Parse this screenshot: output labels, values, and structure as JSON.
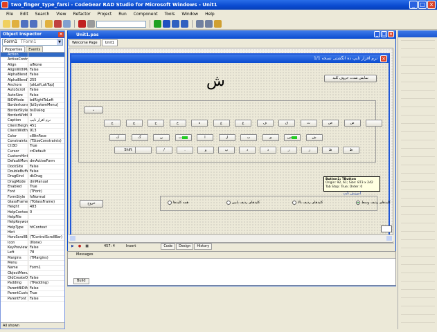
{
  "window": {
    "title": "two_finger_type_farsi - CodeGear RAD Studio for Microsoft Windows - Unit1"
  },
  "menu": [
    "File",
    "Edit",
    "Search",
    "View",
    "Refactor",
    "Project",
    "Run",
    "Component",
    "Tools",
    "Window",
    "Help"
  ],
  "toolbar": {
    "desktop_combo": ""
  },
  "object_inspector": {
    "title": "Object Inspector",
    "selected_object": "Form1",
    "selected_object_type": "TForm1",
    "tabs": [
      "Properties",
      "Events"
    ],
    "properties": [
      [
        "Action",
        ""
      ],
      [
        "ActiveControl",
        ""
      ],
      [
        "Align",
        "alNone"
      ],
      [
        "AlignWithMargins",
        "False"
      ],
      [
        "AlphaBlend",
        "False"
      ],
      [
        "AlphaBlendValue",
        "255"
      ],
      [
        "Anchors",
        "[akLeft,akTop]"
      ],
      [
        "AutoScroll",
        "False"
      ],
      [
        "AutoSize",
        "False"
      ],
      [
        "BiDiMode",
        "bdRightToLeft"
      ],
      [
        "BorderIcons",
        "[biSystemMenu]"
      ],
      [
        "BorderStyle",
        "bsDialog"
      ],
      [
        "BorderWidth",
        "0"
      ],
      [
        "Caption",
        "نرم افزار تایپ"
      ],
      [
        "ClientHeight",
        "451"
      ],
      [
        "ClientWidth",
        "913"
      ],
      [
        "Color",
        "clBtnFace"
      ],
      [
        "Constraints",
        "(TSizeConstraints)"
      ],
      [
        "Ctl3D",
        "True"
      ],
      [
        "Cursor",
        "crDefault"
      ],
      [
        "CustomHint",
        ""
      ],
      [
        "DefaultMonitor",
        "dmActiveForm"
      ],
      [
        "DockSite",
        "False"
      ],
      [
        "DoubleBuffered",
        "False"
      ],
      [
        "DragKind",
        "dkDrag"
      ],
      [
        "DragMode",
        "dmManual"
      ],
      [
        "Enabled",
        "True"
      ],
      [
        "Font",
        "(TFont)"
      ],
      [
        "FormStyle",
        "fsNormal"
      ],
      [
        "GlassFrame",
        "(TGlassFrame)"
      ],
      [
        "Height",
        "483"
      ],
      [
        "HelpContext",
        "0"
      ],
      [
        "HelpFile",
        ""
      ],
      [
        "HelpKeyword",
        ""
      ],
      [
        "HelpType",
        "htContext"
      ],
      [
        "Hint",
        ""
      ],
      [
        "HorzScrollBar",
        "(TControlScrollBar)"
      ],
      [
        "Icon",
        "(None)"
      ],
      [
        "KeyPreview",
        "False"
      ],
      [
        "Left",
        "78"
      ],
      [
        "Margins",
        "(TMargins)"
      ],
      [
        "Menu",
        ""
      ],
      [
        "Name",
        "Form1"
      ],
      [
        "ObjectMenuItem",
        ""
      ],
      [
        "OldCreateOrder",
        "False"
      ],
      [
        "Padding",
        "(TPadding)"
      ],
      [
        "ParentBiDiMode",
        "False"
      ],
      [
        "ParentCustomHint",
        "True"
      ],
      [
        "ParentFont",
        "False"
      ]
    ],
    "status": "All shown"
  },
  "editor": {
    "title": "Unit1.pas",
    "tabs": [
      "Welcome Page",
      "Unit1"
    ],
    "bottom_tabs": [
      "Code",
      "Design",
      "History"
    ],
    "position": "457: 4",
    "mode": "Insert",
    "messages_title": "Messages",
    "build_tab": "Build"
  },
  "form": {
    "title": "نرم افزار تایپ ده انگشتی نسخه 1/1",
    "big_char": "ش",
    "top_button": "نمایش شدت حروف کلید",
    "dropdown_button": "⌄",
    "exit_button": "خروج",
    "link_label": "آموزش تایپ",
    "keyboard_row1": [
      "ج",
      "چ",
      "ح",
      "خ",
      "ه",
      "ع",
      "غ",
      "ف",
      "ق",
      "ث",
      "ص",
      "ض",
      ""
    ],
    "keyboard_row2": [
      "ک",
      "گ",
      "ن",
      "ت",
      "ا",
      "ل",
      "ب",
      "ی",
      "س",
      "ش"
    ],
    "keyboard_row3": [
      "Shift",
      "",
      "/",
      ".",
      "و",
      "پ",
      "د",
      "ذ",
      "ر",
      "ز",
      "ط",
      "ظ"
    ],
    "radios": [
      {
        "label": "کلیدهای ردیف وسط",
        "checked": true
      },
      {
        "label": "کلیدهای ردیف بالا",
        "checked": false
      },
      {
        "label": "کلیدهای ردیف پایین",
        "checked": false
      },
      {
        "label": "همه کلیدها",
        "checked": false
      }
    ],
    "tooltip": [
      "Button1: TButton",
      "Origin: 92, 61; Size: 873 x 242",
      "Tab Stop: True; Order: 0"
    ]
  }
}
